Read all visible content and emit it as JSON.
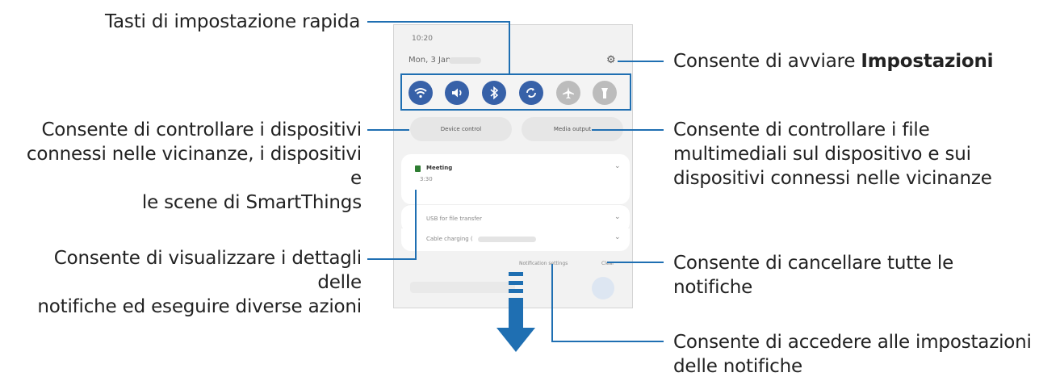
{
  "phone": {
    "time": "10:20",
    "date": "Mon, 3 Jan",
    "settings_icon": "gear-icon",
    "quick_settings": [
      {
        "icon": "wifi-icon",
        "glyph": "◠",
        "state": "on"
      },
      {
        "icon": "sound-icon",
        "glyph": "◀",
        "state": "on"
      },
      {
        "icon": "bluetooth-icon",
        "glyph": "ᛒ",
        "state": "on"
      },
      {
        "icon": "auto-rotate-icon",
        "glyph": "⟲",
        "state": "on"
      },
      {
        "icon": "airplane-icon",
        "glyph": "✈",
        "state": "off"
      },
      {
        "icon": "flashlight-icon",
        "glyph": "♜",
        "state": "off"
      }
    ],
    "device_control": "Device control",
    "media_output": "Media output",
    "notification_title": "Meeting",
    "notification_sub": "3:30",
    "usb_item": "USB for file transfer",
    "charging_item": "Cable charging (",
    "notification_settings": "Notification settings",
    "clear": "Clear",
    "accent_color": "#1f6fb2",
    "toggle_on_color": "#3761a8"
  },
  "annotations": {
    "quick_setting_buttons": "Tasti di impostazione rapida",
    "settings_prefix": "Consente di avviare ",
    "settings_bold": "Impostazioni",
    "device_control_line1": "Consente di controllare i dispositivi",
    "device_control_line2": "connessi nelle vicinanze, i dispositivi e",
    "device_control_line3": "le scene di SmartThings",
    "media_output_line1": "Consente di controllare i file",
    "media_output_line2": "multimediali sul dispositivo e sui",
    "media_output_line3": "dispositivi connessi nelle vicinanze",
    "notification_details_line1": "Consente di visualizzare i dettagli delle",
    "notification_details_line2": "notifiche ed eseguire diverse azioni",
    "clear_line1": "Consente di cancellare tutte le",
    "clear_line2": "notifiche",
    "notif_settings_line1": "Consente di accedere alle impostazioni",
    "notif_settings_line2": "delle notifiche"
  }
}
